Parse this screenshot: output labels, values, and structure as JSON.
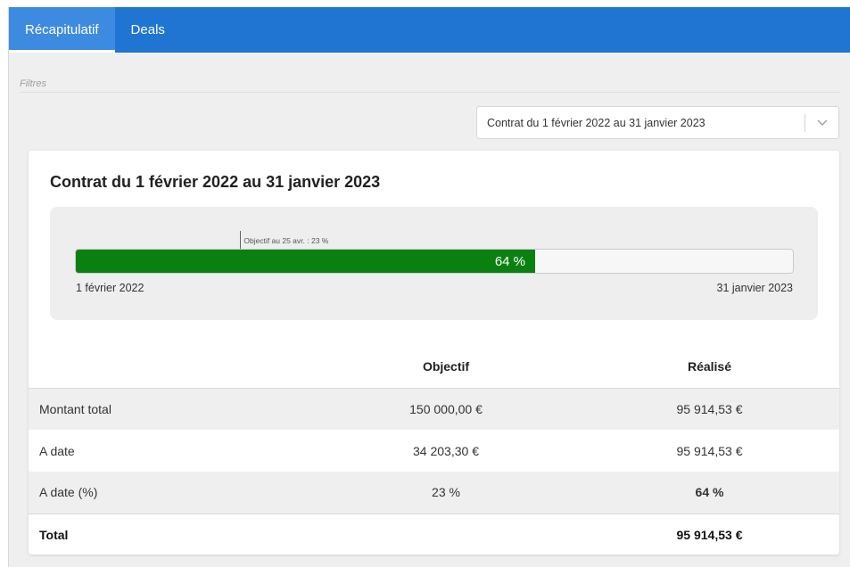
{
  "tabs": [
    {
      "label": "Récapitulatif",
      "active": true
    },
    {
      "label": "Deals",
      "active": false
    }
  ],
  "filters": {
    "label": "Filtres",
    "contract_select": {
      "value": "Contrat du 1 février 2022 au 31 janvier 2023"
    }
  },
  "card": {
    "title": "Contrat du 1 février 2022 au 31 janvier 2023",
    "progress": {
      "target_label": "Objectif au 25 avr. : 23 %",
      "target_percent": 23,
      "value_percent": 64,
      "value_label": "64 %",
      "start_date": "1 février 2022",
      "end_date": "31 janvier 2023",
      "fill_color": "#0a8010"
    },
    "table": {
      "headers": {
        "label": "",
        "objectif": "Objectif",
        "realise": "Réalisé"
      },
      "rows": [
        {
          "label": "Montant total",
          "objectif": "150 000,00 €",
          "realise": "95 914,53 €"
        },
        {
          "label": "A date",
          "objectif": "34 203,30 €",
          "realise": "95 914,53 €"
        },
        {
          "label": "A date (%)",
          "objectif": "23 %",
          "realise": "64 %"
        },
        {
          "label": "Total",
          "objectif": "",
          "realise": "95 914,53 €"
        }
      ]
    }
  },
  "colors": {
    "tabbar": "#1f75d1",
    "active_tab": "#3d8be0",
    "success_green": "#1b8a1b"
  }
}
